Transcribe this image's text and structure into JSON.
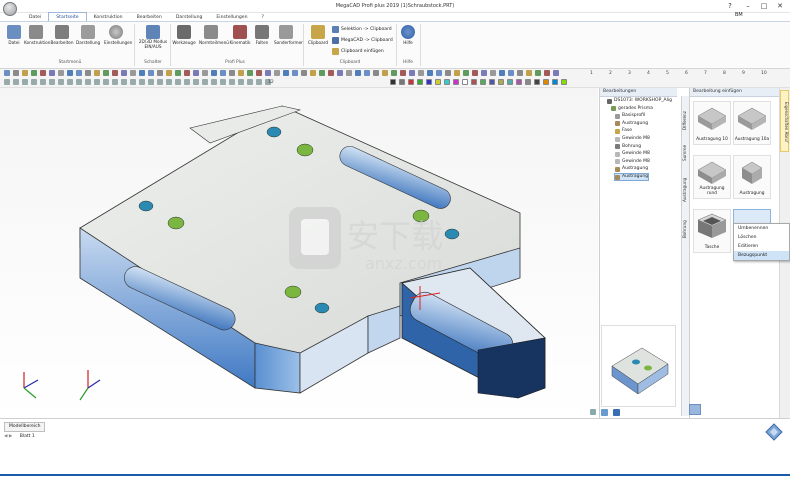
{
  "window": {
    "title": "MegaCAD Profi plus 2019 (1)Schraubstock.PRT)",
    "help_icon": "?",
    "user_label": "BM",
    "minimize": "–",
    "maximize": "□",
    "close": "✕"
  },
  "tabs": [
    "Datei",
    "Startseite",
    "Konstruktion",
    "Bearbeiten",
    "Darstellung",
    "Einstellungen",
    "?"
  ],
  "ribbon": {
    "groups": [
      {
        "label": "Startmenü",
        "buttons": [
          "Datei",
          "Konstruktion",
          "Bearbeiten",
          "Darstellung",
          "Einstellungen"
        ]
      },
      {
        "label": "Schalter",
        "buttons": [
          "2D/3D Modus EIN/AUS"
        ]
      },
      {
        "label": "Profi Plus",
        "buttons": [
          "Werkzeuge",
          "Normteilmenü",
          "Kinematik",
          "Falten",
          "Sonderformen"
        ]
      },
      {
        "label": "Clipboard",
        "buttons": [
          "Clipboard"
        ],
        "small": [
          "Selektion -> Clipboard",
          "MegaCAD -> Clipboard",
          "Clipboard einfügen"
        ]
      },
      {
        "label": "Hilfe",
        "buttons": [
          "Hilfe"
        ]
      }
    ]
  },
  "toolbar": {
    "numbers": [
      "1",
      "2",
      "3",
      "4",
      "5",
      "6",
      "7",
      "8",
      "9",
      "10"
    ],
    "pen_value": "12"
  },
  "tree": {
    "header": "Bearbeitungen",
    "items": [
      "DS1073: WORKSHOP_Alig",
      "gerades Prisma",
      "Basisprofil",
      "Austragung",
      "Fase",
      "Gewinde M8",
      "Bohrung",
      "Gewinde M8",
      "Gewinde M8",
      "Austragung",
      "Austragung"
    ]
  },
  "side_tabs": [
    "Differenz",
    "Summe",
    "Austragung",
    "Bohrung"
  ],
  "insert_panel": {
    "header": "Bearbeitung einfügen",
    "tiles": [
      "Austragung 10",
      "Austragung 10a",
      "Austragung rund",
      "Austragung",
      "Tasche",
      ""
    ]
  },
  "right_strip_tab": "Eigenschaften Abruf",
  "context_menu": {
    "items": [
      "Umbenennen",
      "Löschen",
      "Editieren",
      "Bezugspunkt"
    ],
    "highlight_index": 3
  },
  "bottom": {
    "model_tab": "Modellbereich",
    "layer_label": "Blatt 1"
  },
  "colors": {
    "accent": "#1f4e9a",
    "part_top": "#e2e6e4",
    "part_side_blue": "#3e78c2",
    "hole_teal": "#2a8ab2",
    "hole_green": "#7bb640"
  }
}
